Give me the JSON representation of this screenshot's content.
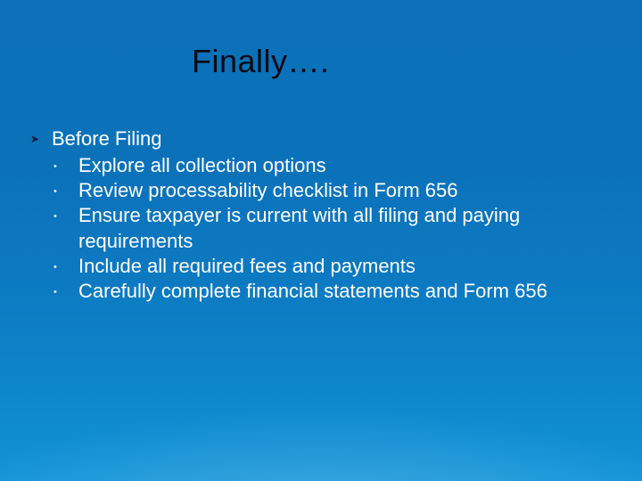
{
  "title": "Finally….",
  "list": {
    "heading": "Before Filing",
    "items": [
      "Explore all collection options",
      "Review processability checklist in Form 656",
      "Ensure taxpayer is current with all filing and paying requirements",
      "Include all required fees and payments",
      "Carefully complete financial statements and Form 656"
    ]
  }
}
